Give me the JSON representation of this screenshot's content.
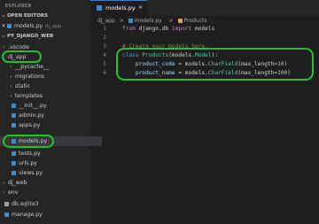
{
  "explorer_title": "EXPLORER",
  "open_editors": {
    "title": "OPEN EDITORS",
    "file": "models.py",
    "folder": "dj_app"
  },
  "project": {
    "title": "PY_DJANGO_WEB",
    "items": [
      {
        "label": ".vscode"
      },
      {
        "label": "dj_app"
      },
      {
        "label": "__pycache__"
      },
      {
        "label": "migrations"
      },
      {
        "label": "static"
      },
      {
        "label": "templates"
      },
      {
        "label": "__init__.py"
      },
      {
        "label": "admin.py"
      },
      {
        "label": "apps.py"
      },
      {
        "label": "models.py"
      },
      {
        "label": "tests.py"
      },
      {
        "label": "urls.py"
      },
      {
        "label": "views.py"
      },
      {
        "label": "dj_web"
      },
      {
        "label": "env"
      },
      {
        "label": "db.sqlite3"
      },
      {
        "label": "manage.py"
      }
    ]
  },
  "editor": {
    "tab_label": "models.py",
    "breadcrumbs": [
      "dj_app",
      ">",
      "models.py",
      ">",
      "Products"
    ],
    "line_numbers": [
      "1",
      "2",
      "3",
      "4",
      "5",
      "6"
    ],
    "lines": {
      "l1a": "from",
      "l1b": " django.db ",
      "l1c": "import",
      "l1d": " models",
      "l3": "# Create your models here.",
      "l4a": "class",
      "l4b": " ",
      "l4c": "Products",
      "l4d": "(models.",
      "l4e": "Model",
      "l4f": "):",
      "l5a": "    product_code",
      "l5b": " = models.",
      "l5c": "CharField",
      "l5d": "(max_length=",
      "l5e": "10",
      "l5f": ")",
      "l6a": "    product_name",
      "l6b": " = models.",
      "l6c": "CharField",
      "l6d": "(max_length=",
      "l6e": "100",
      "l6f": ")"
    }
  },
  "colors": {
    "highlight": "#22c12f",
    "python_file": "#3b8bd0",
    "class_icon": "#e8a33b"
  }
}
